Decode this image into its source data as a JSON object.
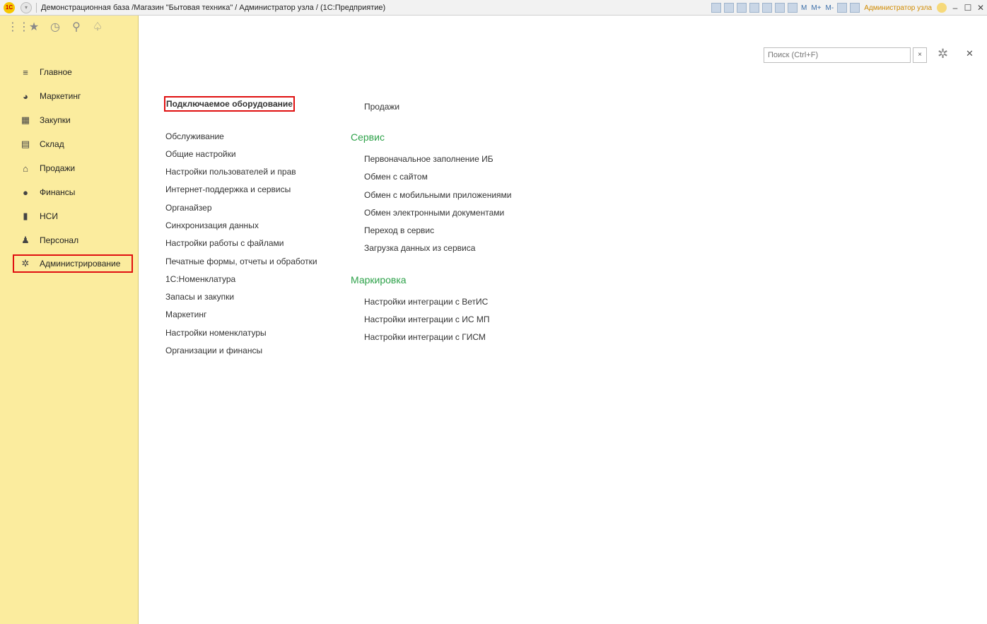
{
  "title_bar": {
    "logo": "1С",
    "title": "Демонстрационная база /Магазин \"Бытовая техника\" / Администратор узла / (1С:Предприятие)",
    "m_buttons": [
      "M",
      "M+",
      "M-"
    ],
    "user": "Администратор узла"
  },
  "sidebar": {
    "items": [
      {
        "label": "Главное",
        "icon": "menu-lines-icon"
      },
      {
        "label": "Маркетинг",
        "icon": "pie-chart-icon"
      },
      {
        "label": "Закупки",
        "icon": "cart-icon"
      },
      {
        "label": "Склад",
        "icon": "warehouse-icon"
      },
      {
        "label": "Продажи",
        "icon": "basket-icon"
      },
      {
        "label": "Финансы",
        "icon": "ruble-icon"
      },
      {
        "label": "НСИ",
        "icon": "documents-icon"
      },
      {
        "label": "Персонал",
        "icon": "person-icon"
      },
      {
        "label": "Администрирование",
        "icon": "gear-icon",
        "active": true
      }
    ]
  },
  "search": {
    "placeholder": "Поиск (Ctrl+F)"
  },
  "content": {
    "column1": [
      "Подключаемое оборудование",
      "Обслуживание",
      "Общие настройки",
      "Настройки пользователей и прав",
      "Интернет-поддержка и сервисы",
      "Органайзер",
      "Синхронизация данных",
      "Настройки работы с файлами",
      "Печатные формы, отчеты и обработки",
      "1С:Номенклатура",
      "Запасы и закупки",
      "Маркетинг",
      "Настройки номенклатуры",
      "Организации и финансы"
    ],
    "sales_link": "Продажи",
    "service_group": {
      "title": "Сервис",
      "items": [
        "Первоначальное заполнение ИБ",
        "Обмен с сайтом",
        "Обмен с мобильными приложениями",
        "Обмен электронными документами",
        "Переход в сервис",
        "Загрузка данных из сервиса"
      ]
    },
    "marking_group": {
      "title": "Маркировка",
      "items": [
        "Настройки интеграции с ВетИС",
        "Настройки интеграции с ИС МП",
        "Настройки интеграции с ГИСМ"
      ]
    }
  }
}
